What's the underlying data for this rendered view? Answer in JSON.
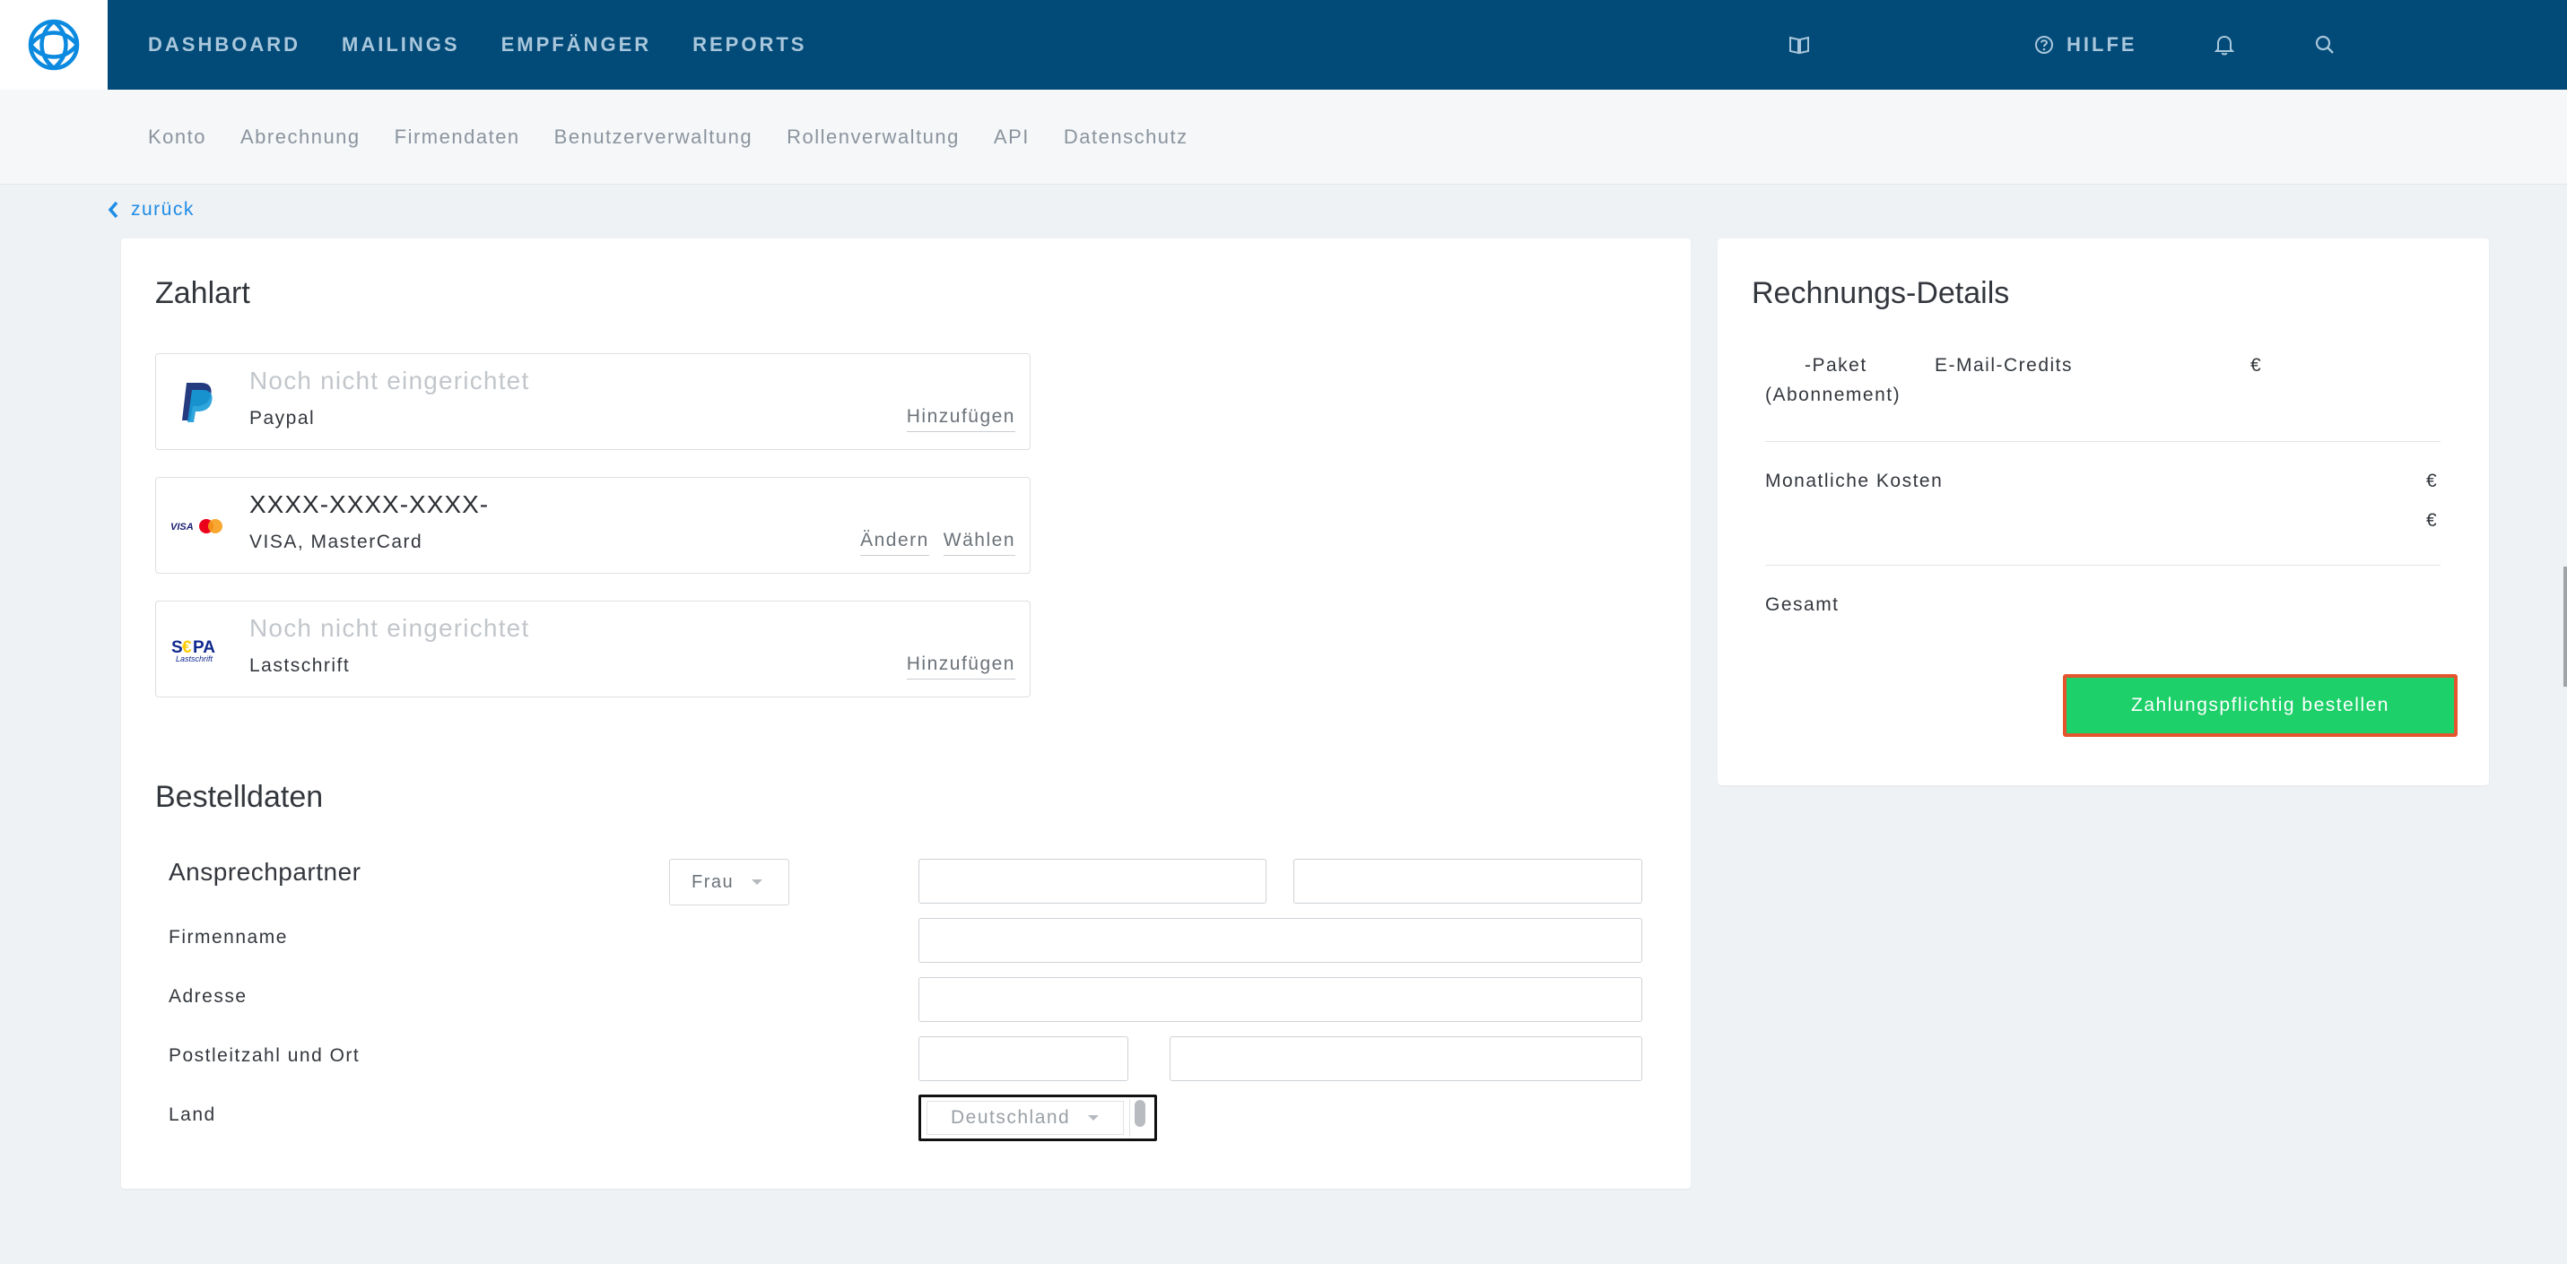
{
  "nav": {
    "items": [
      "DASHBOARD",
      "MAILINGS",
      "EMPFÄNGER",
      "REPORTS"
    ],
    "help_label": "HILFE"
  },
  "subnav": {
    "items": [
      "Konto",
      "Abrechnung",
      "Firmendaten",
      "Benutzerverwaltung",
      "Rollenverwaltung",
      "API",
      "Datenschutz"
    ]
  },
  "back_label": "zurück",
  "payment": {
    "title": "Zahlart",
    "methods": [
      {
        "status": "Noch nicht eingerichtet",
        "name": "Paypal",
        "actions": [
          "Hinzufügen"
        ],
        "logo": "paypal-logo"
      },
      {
        "status": "XXXX-XXXX-XXXX-",
        "name": "VISA, MasterCard",
        "actions": [
          "Ändern",
          "Wählen"
        ],
        "logo": "visa-mastercard-logo"
      },
      {
        "status": "Noch nicht eingerichtet",
        "name": "Lastschrift",
        "actions": [
          "Hinzufügen"
        ],
        "logo": "sepa-logo"
      }
    ]
  },
  "order": {
    "title": "Bestelldaten",
    "contact_label": "Ansprechpartner",
    "salutation": "Frau",
    "company_label": "Firmenname",
    "address_label": "Adresse",
    "zip_city_label": "Postleitzahl und Ort",
    "country_label": "Land",
    "country_value": "Deutschland"
  },
  "invoice": {
    "title": "Rechnungs-Details",
    "package_line": "-Paket",
    "package_sub": "(Abonnement)",
    "credits_label": "E-Mail-Credits",
    "currency": "€",
    "monthly_label": "Monatliche Kosten",
    "total_label": "Gesamt",
    "order_button": "Zahlungspflichtig bestellen"
  },
  "colors": {
    "topbar": "#024a77",
    "accent": "#1f8ce6",
    "button": "#1ed06a",
    "button_border": "#e4552e"
  }
}
